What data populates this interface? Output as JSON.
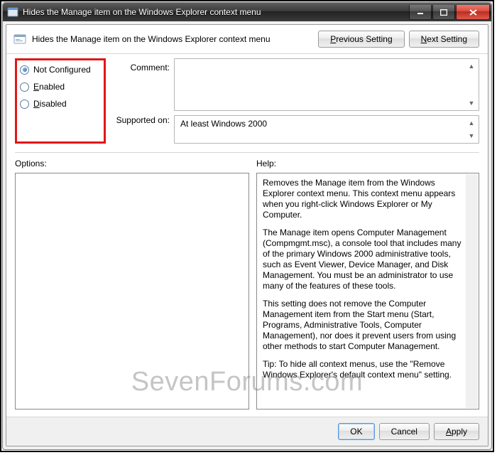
{
  "window": {
    "title": "Hides the Manage item on the Windows Explorer context menu"
  },
  "header": {
    "policy_name": "Hides the Manage item on the Windows Explorer context menu",
    "prev_label": "Previous Setting",
    "next_label": "Next Setting"
  },
  "state": {
    "options": [
      "Not Configured",
      "Enabled",
      "Disabled"
    ],
    "selected_index": 0
  },
  "labels": {
    "comment": "Comment:",
    "supported": "Supported on:",
    "options": "Options:",
    "help": "Help:"
  },
  "fields": {
    "comment_value": "",
    "supported_value": "At least Windows 2000"
  },
  "help_text": {
    "p1": "Removes the Manage item from the Windows Explorer context menu. This context menu appears when you right-click Windows Explorer or My Computer.",
    "p2": "The Manage item opens Computer Management (Compmgmt.msc), a console tool that includes many of the primary Windows 2000 administrative tools, such as Event Viewer, Device Manager, and Disk Management. You must be an administrator to use many of the features of these tools.",
    "p3": "This setting does not remove the Computer Management item from the Start menu (Start, Programs, Administrative Tools, Computer Management), nor does it prevent users from using other methods to start Computer Management.",
    "p4": "Tip: To hide all context menus, use the \"Remove Windows Explorer's default context menu\" setting."
  },
  "footer": {
    "ok": "OK",
    "cancel": "Cancel",
    "apply": "Apply"
  },
  "watermark": "SevenForums.com"
}
